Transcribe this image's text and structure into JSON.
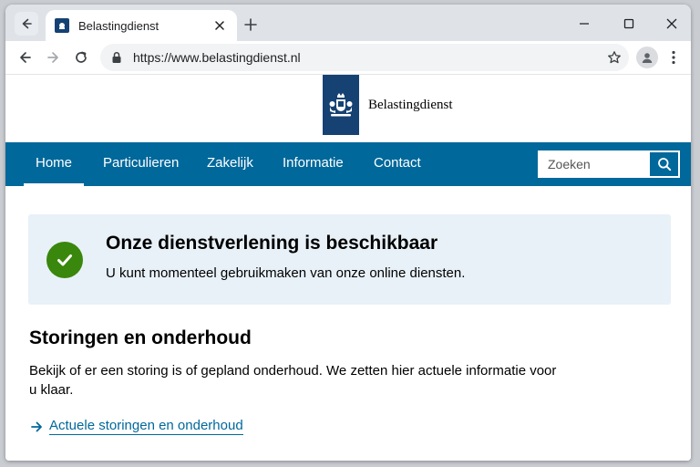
{
  "browser": {
    "tab_title": "Belastingdienst",
    "url": "https://www.belastingdienst.nl"
  },
  "site": {
    "logo_text": "Belastingdienst",
    "nav": [
      {
        "label": "Home",
        "active": true
      },
      {
        "label": "Particulieren",
        "active": false
      },
      {
        "label": "Zakelijk",
        "active": false
      },
      {
        "label": "Informatie",
        "active": false
      },
      {
        "label": "Contact",
        "active": false
      }
    ],
    "search_placeholder": "Zoeken"
  },
  "status": {
    "title": "Onze dienstverlening is beschikbaar",
    "text": "U kunt momenteel gebruikmaken van onze online diensten."
  },
  "section": {
    "heading": "Storingen en onderhoud",
    "body": "Bekijk of er een storing is of gepland onderhoud. We zetten hier actuele informatie voor u klaar.",
    "link": "Actuele storingen en onderhoud"
  },
  "colors": {
    "brand_blue": "#154273",
    "nav_blue": "#01689b",
    "status_bg": "#e8f1f8",
    "success_green": "#39870c"
  }
}
